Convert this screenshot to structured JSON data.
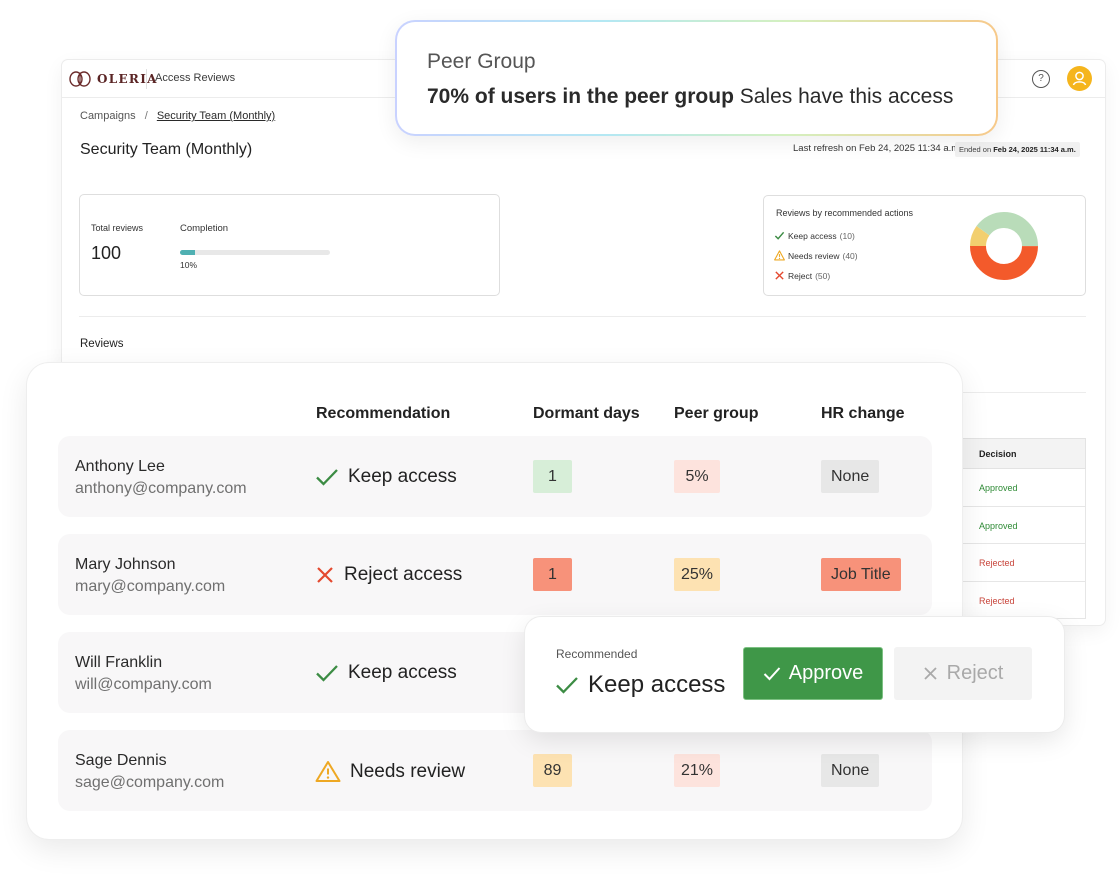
{
  "app": {
    "brand": "OLERIA",
    "title": "Access Reviews",
    "help_glyph": "?"
  },
  "breadcrumb": {
    "root": "Campaigns",
    "separator": "/",
    "current": "Security Team (Monthly)"
  },
  "page": {
    "title": "Security Team (Monthly)",
    "last_refresh": "Last refresh on Feb 24, 2025 11:34 a.m.",
    "ended_prefix": "Ended on",
    "ended_value": "Feb 24, 2025 11:34 a.m."
  },
  "stats": {
    "total_label": "Total reviews",
    "total_value": "100",
    "completion_label": "Completion",
    "completion_pct_text": "10%",
    "completion_fraction": 0.1
  },
  "recommended_actions": {
    "title": "Reviews by recommended actions",
    "items": [
      {
        "label": "Keep access",
        "count": "(10)"
      },
      {
        "label": "Needs review",
        "count": "(40)"
      },
      {
        "label": "Reject",
        "count": "(50)"
      }
    ],
    "donut": [
      {
        "value": 10,
        "color": "#f2cf6f"
      },
      {
        "value": 40,
        "color": "#b9dcb9"
      },
      {
        "value": 50,
        "color": "#f35a2b"
      }
    ]
  },
  "reviews": {
    "section_label": "Reviews",
    "decision_header": "Decision",
    "decisions": [
      "Approved",
      "Approved",
      "Rejected",
      "Rejected"
    ]
  },
  "peer_tooltip": {
    "title": "Peer Group",
    "bold_text": "70% of users in the peer group",
    "rest_text": " Sales have this access"
  },
  "table": {
    "headers": {
      "recommendation": "Recommendation",
      "dormant": "Dormant days",
      "peer": "Peer group",
      "hr": "HR change"
    },
    "rows": [
      {
        "name": "Anthony Lee",
        "email": "anthony@company.com",
        "recommendation": "Keep access",
        "dormant": "1",
        "peer": "5%",
        "hr": "None"
      },
      {
        "name": "Mary Johnson",
        "email": "mary@company.com",
        "recommendation": "Reject access",
        "dormant": "1",
        "peer": "25%",
        "hr": "Job Title"
      },
      {
        "name": "Will Franklin",
        "email": "will@company.com",
        "recommendation": "Keep access",
        "dormant": "",
        "peer": "",
        "hr": ""
      },
      {
        "name": "Sage Dennis",
        "email": "sage@company.com",
        "recommendation": "Needs review",
        "dormant": "89",
        "peer": "21%",
        "hr": "None"
      }
    ]
  },
  "action_popup": {
    "label": "Recommended",
    "recommendation": "Keep access",
    "approve_label": "Approve",
    "reject_label": "Reject"
  },
  "colors": {
    "approve_green": "#3f9748",
    "check_green": "#3c8c44",
    "reject_red": "#e4492f",
    "warning_amber": "#eea823",
    "avatar_yellow": "#f5b51d",
    "progress_teal": "#4fb0b2"
  }
}
